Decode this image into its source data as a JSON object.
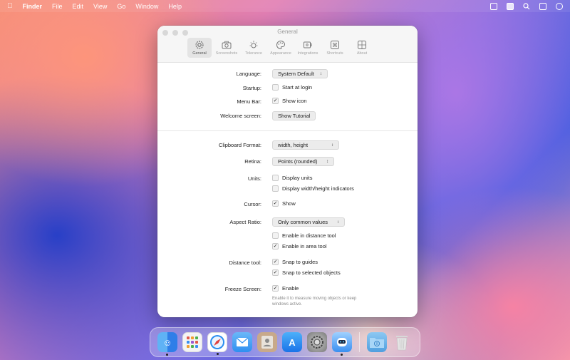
{
  "menubar": {
    "app": "Finder",
    "items": [
      "File",
      "Edit",
      "View",
      "Go",
      "Window",
      "Help"
    ],
    "status_icons": [
      "screen-capture-icon",
      "menu-app-icon",
      "search-icon",
      "control-center-icon",
      "more-icon"
    ]
  },
  "window": {
    "title": "General",
    "tabs": [
      {
        "label": "General",
        "icon": "gear-icon",
        "active": true
      },
      {
        "label": "Screenshots",
        "icon": "camera-icon",
        "active": false
      },
      {
        "label": "Tolerance",
        "icon": "tolerance-icon",
        "active": false
      },
      {
        "label": "Appearance",
        "icon": "palette-icon",
        "active": false
      },
      {
        "label": "Integrations",
        "icon": "integrations-icon",
        "active": false
      },
      {
        "label": "Shortcuts",
        "icon": "command-icon",
        "active": false
      },
      {
        "label": "About",
        "icon": "about-icon",
        "active": false
      }
    ]
  },
  "general": {
    "language_label": "Language:",
    "language_value": "System Default",
    "startup_label": "Startup:",
    "startup_option": "Start at login",
    "startup_checked": false,
    "menubar_label": "Menu Bar:",
    "menubar_option": "Show icon",
    "menubar_checked": true,
    "welcome_label": "Welcome screen:",
    "welcome_button": "Show Tutorial"
  },
  "measure": {
    "clipboard_label": "Clipboard Format:",
    "clipboard_value": "width, height",
    "retina_label": "Retina:",
    "retina_value": "Points (rounded)",
    "units_label": "Units:",
    "units_option1": "Display units",
    "units_option1_checked": false,
    "units_option2": "Display width/height indicators",
    "units_option2_checked": false,
    "cursor_label": "Cursor:",
    "cursor_option": "Show",
    "cursor_checked": true,
    "aspect_label": "Aspect Ratio:",
    "aspect_value": "Only common values",
    "aspect_option1": "Enable in distance tool",
    "aspect_option1_checked": false,
    "aspect_option2": "Enable in area tool",
    "aspect_option2_checked": true,
    "distance_label": "Distance tool:",
    "distance_option1": "Snap to guides",
    "distance_option1_checked": true,
    "distance_option2": "Snap to selected objects",
    "distance_option2_checked": true,
    "freeze_label": "Freeze Screen:",
    "freeze_option": "Enable",
    "freeze_checked": true,
    "freeze_hint": "Enable it to measure moving objects or keep windows active."
  },
  "check_glyph": "✓",
  "chevron_glyph": "⌃⌄",
  "dock": {
    "apps": [
      {
        "name": "Finder",
        "icon": "finder-icon",
        "color": "#3a8ff0",
        "running": true
      },
      {
        "name": "Launchpad",
        "icon": "launchpad-icon",
        "color": "#f2f2f2",
        "running": false
      },
      {
        "name": "Safari",
        "icon": "safari-icon",
        "color": "#ffffff",
        "running": true
      },
      {
        "name": "Mail",
        "icon": "mail-icon",
        "color": "#4aa3f5",
        "running": false
      },
      {
        "name": "Contacts",
        "icon": "contacts-icon",
        "color": "#c8a98a",
        "running": false
      },
      {
        "name": "App Store",
        "icon": "app-store-icon",
        "color": "#2f8ff5",
        "running": false
      },
      {
        "name": "System Settings",
        "icon": "settings-icon",
        "color": "#8a8a8a",
        "running": false
      },
      {
        "name": "Utility",
        "icon": "robot-icon",
        "color": "#5aa0f0",
        "running": true
      },
      {
        "name": "Downloads",
        "icon": "downloads-folder-icon",
        "color": "#6fb6ea",
        "running": false
      },
      {
        "name": "Trash",
        "icon": "trash-icon",
        "color": "#d9d9d9",
        "running": false
      }
    ]
  }
}
